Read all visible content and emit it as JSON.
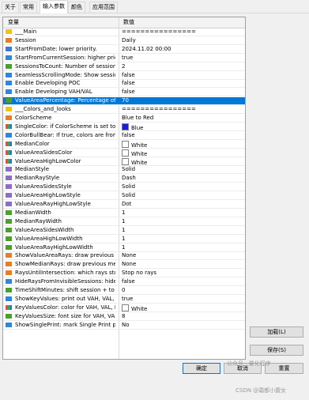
{
  "tabs": [
    "关于",
    "常用",
    "输入参数",
    "颜色",
    "应用范围"
  ],
  "grid": {
    "col_name": "变量",
    "col_value": "数值",
    "rows": [
      {
        "icon": "head",
        "name": "___Main",
        "value": "================"
      },
      {
        "icon": "list",
        "name": "Session",
        "value": "Daily"
      },
      {
        "icon": "str",
        "name": "StartFromDate: lower priority.",
        "value": "2024.11.02 00:00"
      },
      {
        "icon": "bool",
        "name": "StartFromCurrentSession: higher prior...",
        "value": "true"
      },
      {
        "icon": "num",
        "name": "SessionsToCount: Number of sessions...",
        "value": "2"
      },
      {
        "icon": "bool",
        "name": "SeamlessScrollingMode: Show sessio...",
        "value": "false"
      },
      {
        "icon": "bool",
        "name": "Enable Developing POC",
        "value": "false"
      },
      {
        "icon": "bool",
        "name": "Enable Developing VAH/VAL",
        "value": "false"
      },
      {
        "icon": "num",
        "name": "ValueAreaPercentage: Percentage of T...",
        "value": "70",
        "selected": true
      },
      {
        "icon": "head",
        "name": "___Colors_and_looks",
        "value": "================"
      },
      {
        "icon": "list",
        "name": "ColorScheme",
        "value": "Blue to Red"
      },
      {
        "icon": "col",
        "name": "SingleColor: if ColorScheme is set to S...",
        "value": "Blue",
        "swatch": "#1a1ae6"
      },
      {
        "icon": "bool",
        "name": "ColorBullBear: If true, colors are from...",
        "value": "false"
      },
      {
        "icon": "col",
        "name": "MedianColor",
        "value": "White",
        "swatch": "#ffffff"
      },
      {
        "icon": "col",
        "name": "ValueAreaSidesColor",
        "value": "White",
        "swatch": "#ffffff"
      },
      {
        "icon": "col",
        "name": "ValueAreaHighLowColor",
        "value": "White",
        "swatch": "#ffffff"
      },
      {
        "icon": "sty",
        "name": "MedianStyle",
        "value": "Solid"
      },
      {
        "icon": "sty",
        "name": "MedianRayStyle",
        "value": "Dash"
      },
      {
        "icon": "sty",
        "name": "ValueAreaSidesStyle",
        "value": "Solid"
      },
      {
        "icon": "sty",
        "name": "ValueAreaHighLowStyle",
        "value": "Solid"
      },
      {
        "icon": "sty",
        "name": "ValueAreaRayHighLowStyle",
        "value": "Dot"
      },
      {
        "icon": "num",
        "name": "MedianWidth",
        "value": "1"
      },
      {
        "icon": "num",
        "name": "MedianRayWidth",
        "value": "1"
      },
      {
        "icon": "num",
        "name": "ValueAreaSidesWidth",
        "value": "1"
      },
      {
        "icon": "num",
        "name": "ValueAreaHighLowWidth",
        "value": "1"
      },
      {
        "icon": "num",
        "name": "ValueAreaRayHighLowWidth",
        "value": "1"
      },
      {
        "icon": "list",
        "name": "ShowValueAreaRays: draw previous v...",
        "value": "None"
      },
      {
        "icon": "list",
        "name": "ShowMedianRays: draw previous med...",
        "value": "None"
      },
      {
        "icon": "list",
        "name": "RaysUntilIntersection: which rays stop ...",
        "value": "Stop no rays"
      },
      {
        "icon": "bool",
        "name": "HideRaysFromInvisibleSessions: hide r...",
        "value": "false"
      },
      {
        "icon": "num",
        "name": "TimeShiftMinutes: shift session + to the...",
        "value": "0"
      },
      {
        "icon": "bool",
        "name": "ShowKeyValues: print out VAH, VAL, P...",
        "value": "true"
      },
      {
        "icon": "col",
        "name": "KeyValuesColor: color for VAH, VAL, P...",
        "value": "White",
        "swatch": "#ffffff"
      },
      {
        "icon": "num",
        "name": "KeyValuesSize: font size for VAH, VAL...",
        "value": "8"
      },
      {
        "icon": "bool",
        "name": "ShowSinglePrint: mark Single Print pro...",
        "value": "No"
      }
    ]
  },
  "buttons": {
    "load": "加载(L)",
    "save": "保存(S)",
    "ok": "确定",
    "cancel": "取消",
    "reset": "重置"
  },
  "watermark": {
    "brand": "公众号 · 量化程序",
    "csdn": "CSDN @霜都小腹女"
  }
}
